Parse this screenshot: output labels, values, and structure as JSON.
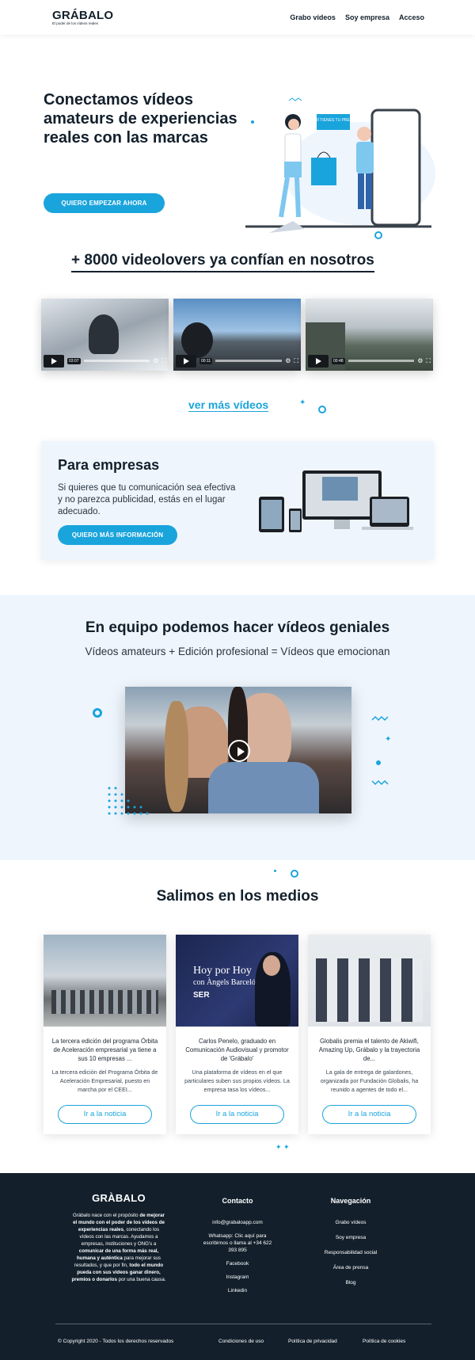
{
  "header": {
    "logo": "GRÁBALO",
    "tagline": "El poder de los vídeos reales",
    "nav": [
      "Grabo vídeos",
      "Soy empresa",
      "Acceso"
    ]
  },
  "hero": {
    "title": "Conectamos vídeos amateurs de experiencias reales con las marcas",
    "cta": "QUIERO EMPEZAR AHORA",
    "prize_text": "AQUÍ TIENES TU PREMIO"
  },
  "stats": {
    "title": "+ 8000 videolovers ya confían en nosotros",
    "videos": [
      {
        "time": "03:07"
      },
      {
        "time": "00:11"
      },
      {
        "time": "00:48"
      }
    ],
    "more": "ver más vídeos"
  },
  "empresas": {
    "title": "Para empresas",
    "text": "Si quieres que tu comunicación sea efectiva y no parezca publicidad, estás en el lugar adecuado.",
    "cta": "QUIERO MÁS INFORMACIÓN"
  },
  "team": {
    "title": "En equipo podemos hacer vídeos geniales",
    "subtitle": "Vídeos amateurs + Edición profesional = Vídeos que emocionan"
  },
  "medios": {
    "title": "Salimos en los medios",
    "cards": [
      {
        "title": "La tercera edición del programa Órbita de Aceleración empresarial ya tiene a sus 10 empresas ...",
        "excerpt": "La tercera edición del Programa Órbita de Aceleración Empresarial, puesto en marcha por el CEEI...",
        "button": "Ir a la noticia"
      },
      {
        "title": "Carlos Penelo, graduado en Comunicación Audiovisual y promotor de 'Grábalo'",
        "excerpt": "Una plataforma de vídeos en el que particulares suben sus propios vídeos. La empresa tasa los vídeos...",
        "button": "Ir a la noticia",
        "image_text": [
          "Hoy por Hoy",
          "con Àngels Barceló",
          "SER"
        ]
      },
      {
        "title": "Globalis premia el talento de Akiwifi, Amazing Up, Grábalo y la trayectoria de...",
        "excerpt": "La gala de entrega de galardones, organizada por Fundación Globalis, ha reunido a agentes de todo el...",
        "button": "Ir a la noticia"
      }
    ]
  },
  "footer": {
    "logo": "GRÀBALO",
    "about": [
      "Grábalo nace con el propósito ",
      "de mejorar el mundo con el poder de los vídeos de experiencias reales",
      ", conectando los vídeos con las marcas. Ayudamos a empresas, instituciones y ONG's a ",
      "comunicar de una forma más real, humana y auténtica",
      " para mejorar sus resultados, y que por fin, ",
      "todo el mundo pueda con sus videos ganar dinero, premios o donarlos",
      " por una buena causa."
    ],
    "contact_title": "Contacto",
    "contact": [
      "info@grabaloapp.com",
      "Whatsapp: Clic aquí para escribirnos o llama al +34 622 393 895",
      "Facebook",
      "Instagram",
      "Linkedin"
    ],
    "nav_title": "Navegación",
    "nav": [
      "Grabo vídeos",
      "Soy empresa",
      "Responsabilidad social",
      "Área de prensa",
      "Blog"
    ],
    "copyright": "© Copyright 2020 - Todos los derechos reservados",
    "legal": [
      "Condiciones de uso",
      "Política de privacidad",
      "Política de cookies"
    ]
  },
  "colors": {
    "accent": "#1aa4dc",
    "dark": "#13202c",
    "light_bg": "#eef5fd"
  }
}
